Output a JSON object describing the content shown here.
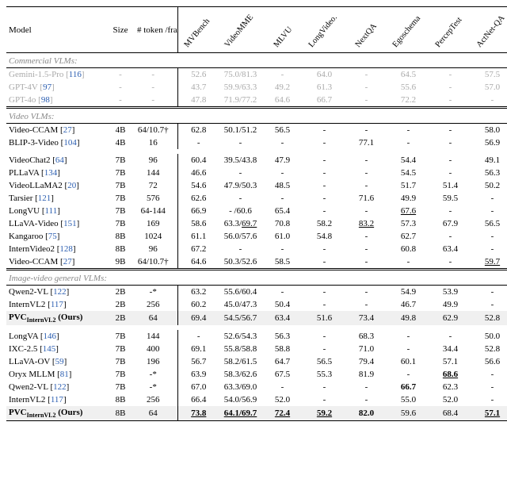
{
  "headers": {
    "model": "Model",
    "size": "Size",
    "tokens": "# token /frame",
    "metrics": [
      "MVBench",
      "VideoMME",
      "MLVU",
      "LongVideo.",
      "NextQA",
      "Egoschema",
      "PercepTest",
      "ActNet-QA"
    ]
  },
  "sections": [
    {
      "title": "Commercial VLMs:",
      "faded": true,
      "rows": [
        {
          "model": "Gemini-1.5-Pro",
          "ref": "116",
          "size": "-",
          "tok": "-",
          "vals": [
            "52.6",
            "75.0/81.3",
            "-",
            "64.0",
            "-",
            "64.5",
            "-",
            "57.5"
          ]
        },
        {
          "model": "GPT-4V",
          "ref": "97",
          "size": "-",
          "tok": "-",
          "vals": [
            "43.7",
            "59.9/63.3",
            "49.2",
            "61.3",
            "-",
            "55.6",
            "-",
            "57.0"
          ]
        },
        {
          "model": "GPT-4o",
          "ref": "98",
          "size": "-",
          "tok": "-",
          "vals": [
            "47.8",
            "71.9/77.2",
            "64.6",
            "66.7",
            "-",
            "72.2",
            "-",
            "-"
          ]
        }
      ]
    },
    {
      "title": "Video VLMs:",
      "rows": [
        {
          "model": "Video-CCAM",
          "ref": "27",
          "size": "4B",
          "tok": "64/10.7†",
          "vals": [
            "62.8",
            "50.1/51.2",
            "56.5",
            "-",
            "-",
            "-",
            "-",
            "58.0"
          ]
        },
        {
          "model": "BLIP-3-Video",
          "ref": "104",
          "size": "4B",
          "tok": "16",
          "vals": [
            "-",
            "-",
            "-",
            "-",
            "77.1",
            "-",
            "-",
            "56.9"
          ],
          "gap_after": true
        },
        {
          "model": "VideoChat2",
          "ref": "64",
          "size": "7B",
          "tok": "96",
          "vals": [
            "60.4",
            "39.5/43.8",
            "47.9",
            "-",
            "-",
            "54.4",
            "-",
            "49.1"
          ]
        },
        {
          "model": "PLLaVA",
          "ref": "134",
          "size": "7B",
          "tok": "144",
          "vals": [
            "46.6",
            "-",
            "-",
            "-",
            "-",
            "54.5",
            "-",
            "56.3"
          ]
        },
        {
          "model": "VideoLLaMA2",
          "ref": "20",
          "size": "7B",
          "tok": "72",
          "vals": [
            "54.6",
            "47.9/50.3",
            "48.5",
            "-",
            "-",
            "51.7",
            "51.4",
            "50.2"
          ]
        },
        {
          "model": "Tarsier",
          "ref": "121",
          "size": "7B",
          "tok": "576",
          "vals": [
            "62.6",
            "-",
            "-",
            "-",
            "71.6",
            "49.9",
            "59.5",
            "-"
          ]
        },
        {
          "model": "LongVU",
          "ref": "111",
          "size": "7B",
          "tok": "64-144",
          "vals": [
            "66.9",
            "- /60.6",
            "65.4",
            "-",
            "-",
            {
              "t": "67.6",
              "u": true
            },
            "-",
            "-"
          ]
        },
        {
          "model": "LLaVA-Video",
          "ref": "151",
          "size": "7B",
          "tok": "169",
          "vals": [
            "58.6",
            {
              "t": "63.3/69.7",
              "u": "part",
              "upart": "69.7"
            },
            "70.8",
            "58.2",
            {
              "t": "83.2",
              "u": true
            },
            "57.3",
            "67.9",
            "56.5"
          ]
        },
        {
          "model": "Kangaroo",
          "ref": "75",
          "size": "8B",
          "tok": "1024",
          "vals": [
            "61.1",
            "56.0/57.6",
            "61.0",
            "54.8",
            "-",
            "62.7",
            "-",
            "-"
          ]
        },
        {
          "model": "InternVideo2",
          "ref": "128",
          "size": "8B",
          "tok": "96",
          "vals": [
            "67.2",
            "-",
            "-",
            "-",
            "-",
            "60.8",
            "63.4",
            "-"
          ]
        },
        {
          "model": "Video-CCAM",
          "ref": "27",
          "size": "9B",
          "tok": "64/10.7†",
          "vals": [
            "64.6",
            "50.3/52.6",
            "58.5",
            "-",
            "-",
            "-",
            "-",
            {
              "t": "59.7",
              "u": true
            }
          ]
        }
      ]
    },
    {
      "title": "Image-video general VLMs:",
      "rows": [
        {
          "model": "Qwen2-VL",
          "ref": "122",
          "size": "2B",
          "tok": "-*",
          "vals": [
            "63.2",
            "55.6/60.4",
            "-",
            "-",
            "-",
            "54.9",
            "53.9",
            "-"
          ]
        },
        {
          "model": "InternVL2",
          "ref": "117",
          "size": "2B",
          "tok": "256",
          "vals": [
            "60.2",
            "45.0/47.3",
            "50.4",
            "-",
            "-",
            "46.7",
            "49.9",
            "-"
          ]
        },
        {
          "model": "PVCInternVL2 (Ours)",
          "sub": "InternVL2",
          "size": "2B",
          "tok": "64",
          "hl": true,
          "vals": [
            "69.4",
            "54.5/56.7",
            "63.4",
            "51.6",
            "73.4",
            "49.8",
            "62.9",
            "52.8"
          ],
          "gap_after": true
        },
        {
          "model": "LongVA",
          "ref": "146",
          "size": "7B",
          "tok": "144",
          "vals": [
            "-",
            "52.6/54.3",
            "56.3",
            "-",
            "68.3",
            "-",
            "-",
            "50.0"
          ]
        },
        {
          "model": "IXC-2.5",
          "ref": "145",
          "size": "7B",
          "tok": "400",
          "vals": [
            "69.1",
            "55.8/58.8",
            "58.8",
            "-",
            "71.0",
            "-",
            "34.4",
            "52.8"
          ]
        },
        {
          "model": "LLaVA-OV",
          "ref": "59",
          "size": "7B",
          "tok": "196",
          "vals": [
            "56.7",
            "58.2/61.5",
            "64.7",
            "56.5",
            "79.4",
            "60.1",
            "57.1",
            "56.6"
          ]
        },
        {
          "model": "Oryx MLLM",
          "ref": "81",
          "size": "7B",
          "tok": "-*",
          "vals": [
            "63.9",
            "58.3/62.6",
            "67.5",
            "55.3",
            "81.9",
            "-",
            {
              "t": "68.6",
              "b": true,
              "u": true
            },
            "-"
          ]
        },
        {
          "model": "Qwen2-VL",
          "ref": "122",
          "size": "7B",
          "tok": "-*",
          "vals": [
            "67.0",
            "63.3/69.0",
            "-",
            "-",
            "-",
            {
              "t": "66.7",
              "b": true
            },
            "62.3",
            "-"
          ]
        },
        {
          "model": "InternVL2",
          "ref": "117",
          "size": "8B",
          "tok": "256",
          "vals": [
            "66.4",
            "54.0/56.9",
            "52.0",
            "-",
            "-",
            "55.0",
            "52.0",
            "-"
          ]
        },
        {
          "model": "PVCInternVL2 (Ours)",
          "sub": "InternVL2",
          "size": "8B",
          "tok": "64",
          "hl": true,
          "vals": [
            {
              "t": "73.8",
              "b": true,
              "u": true
            },
            {
              "t": "64.1/69.7",
              "b": true,
              "u": true
            },
            {
              "t": "72.4",
              "b": true,
              "u": true
            },
            {
              "t": "59.2",
              "b": true,
              "u": true
            },
            {
              "t": "82.0",
              "b": true
            },
            "59.6",
            "68.4",
            {
              "t": "57.1",
              "b": true,
              "u": true
            }
          ]
        }
      ]
    }
  ]
}
